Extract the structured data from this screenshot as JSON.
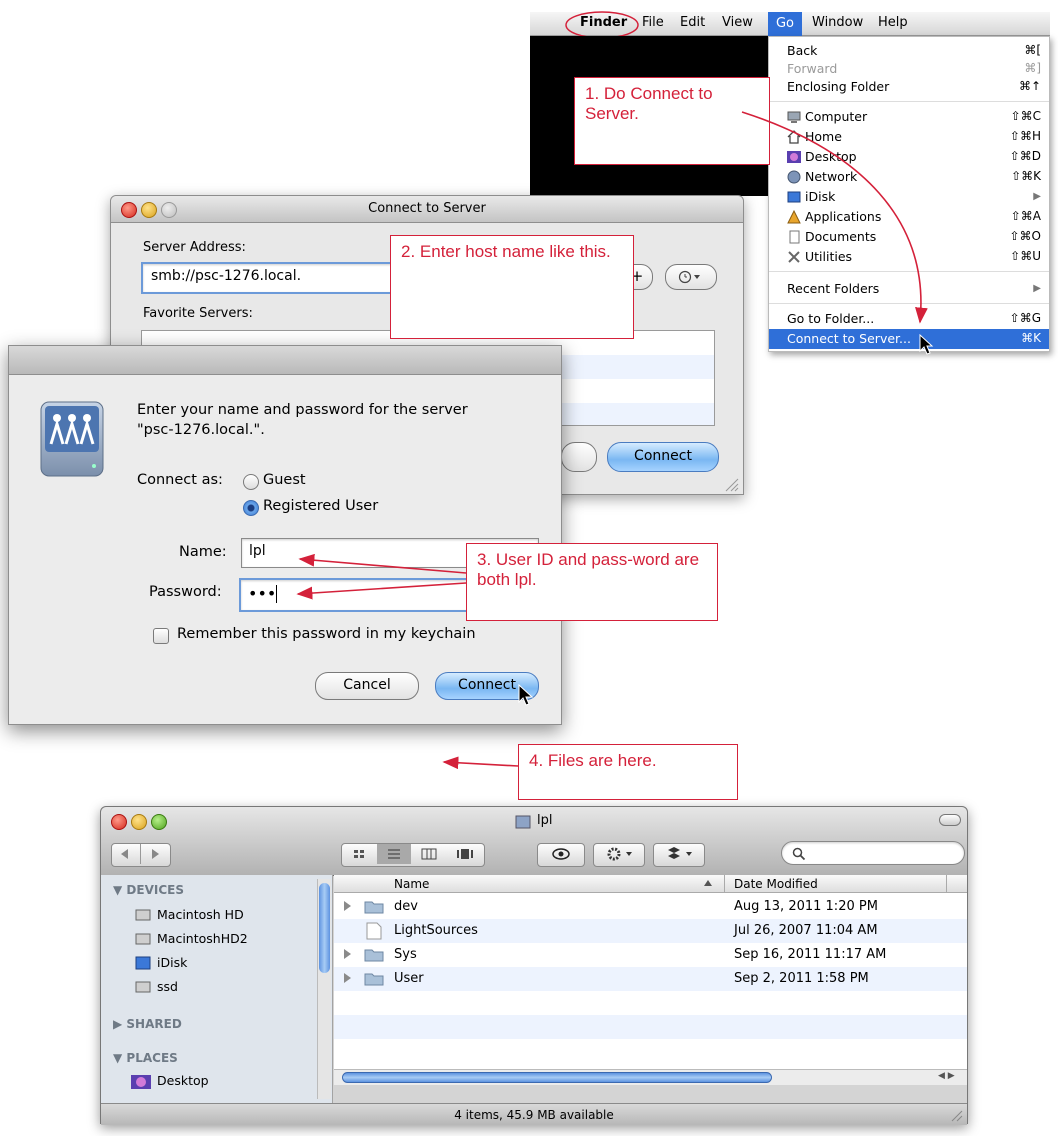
{
  "menubar": {
    "items": [
      "Finder",
      "File",
      "Edit",
      "View",
      "Go",
      "Window",
      "Help"
    ],
    "active": "Go"
  },
  "go_menu": {
    "items": [
      {
        "label": "Back",
        "shortcut": "⌘["
      },
      {
        "label": "Forward",
        "shortcut": "⌘]"
      },
      {
        "label": "Enclosing Folder",
        "shortcut": "⌘↑"
      },
      {
        "label": "Computer",
        "shortcut": "⇧⌘C",
        "icon": "computer-icon"
      },
      {
        "label": "Home",
        "shortcut": "⇧⌘H",
        "icon": "home-icon"
      },
      {
        "label": "Desktop",
        "shortcut": "⇧⌘D",
        "icon": "desktop-icon"
      },
      {
        "label": "Network",
        "shortcut": "⇧⌘K",
        "icon": "network-icon"
      },
      {
        "label": "iDisk",
        "shortcut": "▶",
        "icon": "idisk-icon"
      },
      {
        "label": "Applications",
        "shortcut": "⇧⌘A",
        "icon": "applications-icon"
      },
      {
        "label": "Documents",
        "shortcut": "⇧⌘O",
        "icon": "documents-icon"
      },
      {
        "label": "Utilities",
        "shortcut": "⇧⌘U",
        "icon": "utilities-icon"
      },
      {
        "label": "Recent Folders",
        "shortcut": "▶"
      },
      {
        "label": "Go to Folder...",
        "shortcut": "⇧⌘G"
      },
      {
        "label": "Connect to Server...",
        "shortcut": "⌘K"
      }
    ]
  },
  "notes": {
    "n1": "1. Do Connect to Server.",
    "n2": "2. Enter host name like this.",
    "n3": "3. User ID and pass-word are both lpl.",
    "n4": "4. Files are here."
  },
  "connect_window": {
    "title": "Connect to Server",
    "server_address_label": "Server Address:",
    "server_address_value": "smb://psc-1276.local.",
    "add_button": "+",
    "favorite_label": "Favorite Servers:",
    "connect_button": "Connect"
  },
  "auth_sheet": {
    "prompt_line1": "Enter your name and password for the server",
    "prompt_line2": "\"psc-1276.local.\".",
    "connect_as_label": "Connect as:",
    "guest_label": "Guest",
    "registered_label": "Registered User",
    "name_label": "Name:",
    "name_value": "lpl",
    "password_label": "Password:",
    "password_value": "•••",
    "remember_label": "Remember this password in my keychain",
    "cancel_button": "Cancel",
    "connect_button": "Connect"
  },
  "finder": {
    "title": "lpl",
    "search_placeholder": "",
    "sidebar": {
      "devices_header": "DEVICES",
      "devices": [
        "Macintosh HD",
        "MacintoshHD2",
        "iDisk",
        "ssd"
      ],
      "shared_header": "SHARED",
      "places_header": "PLACES",
      "places": [
        "Desktop"
      ]
    },
    "columns": {
      "name": "Name",
      "date": "Date Modified"
    },
    "rows": [
      {
        "name": "dev",
        "date": "Aug 13, 2011 1:20 PM"
      },
      {
        "name": "LightSources",
        "date": "Jul 26, 2007 11:04 AM"
      },
      {
        "name": "Sys",
        "date": "Sep 16, 2011 11:17 AM"
      },
      {
        "name": "User",
        "date": "Sep 2, 2011 1:58 PM"
      }
    ],
    "status": "4 items, 45.9 MB available"
  }
}
